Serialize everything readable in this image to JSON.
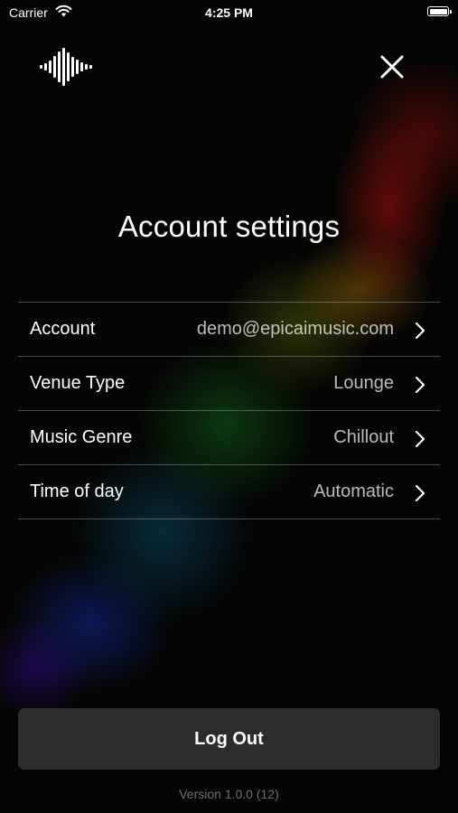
{
  "status_bar": {
    "carrier": "Carrier",
    "time": "4:25 PM",
    "icons": [
      "wifi-icon",
      "battery-icon"
    ]
  },
  "header": {
    "logo_icon": "waveform-logo-icon",
    "close_icon": "close-icon"
  },
  "title": "Account settings",
  "settings": [
    {
      "label": "Account",
      "value": "demo@epicaimusic.com"
    },
    {
      "label": "Venue Type",
      "value": "Lounge"
    },
    {
      "label": "Music Genre",
      "value": "Chillout"
    },
    {
      "label": "Time of day",
      "value": "Automatic"
    }
  ],
  "logout_label": "Log Out",
  "version": "Version 1.0.0 (12)",
  "colors": {
    "background": "#000000",
    "text": "#ffffff",
    "button_bg": "#3c3c3c"
  }
}
